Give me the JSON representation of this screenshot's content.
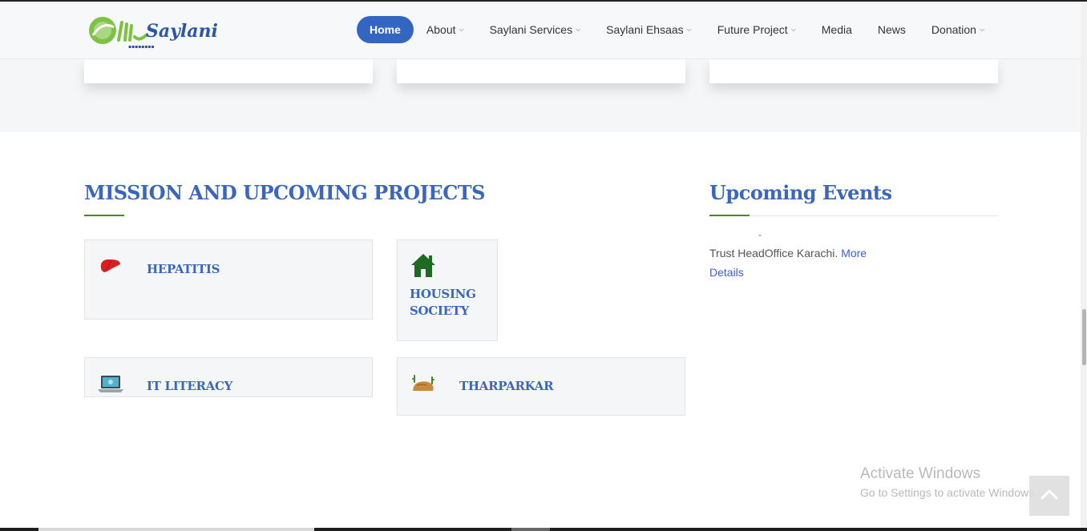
{
  "header": {
    "logo_text": "Saylani",
    "nav": [
      {
        "label": "Home",
        "active": true,
        "dropdown": false
      },
      {
        "label": "About",
        "active": false,
        "dropdown": true
      },
      {
        "label": "Saylani Services",
        "active": false,
        "dropdown": true
      },
      {
        "label": "Saylani Ehsaas",
        "active": false,
        "dropdown": true
      },
      {
        "label": "Future Project",
        "active": false,
        "dropdown": true
      },
      {
        "label": "Media",
        "active": false,
        "dropdown": false
      },
      {
        "label": "News",
        "active": false,
        "dropdown": false
      },
      {
        "label": "Donation",
        "active": false,
        "dropdown": true
      }
    ]
  },
  "mission": {
    "title": "MISSION AND UPCOMING PROJECTS",
    "projects": [
      {
        "label": "HEPATITIS",
        "icon": "liver-icon"
      },
      {
        "label": "HOUSING SOCIETY",
        "icon": "house-icon"
      },
      {
        "label": "IT LITERACY",
        "icon": "laptop-icon"
      },
      {
        "label": "THARPARKAR",
        "icon": "desert-rock-icon"
      }
    ]
  },
  "events": {
    "title": "Upcoming Events",
    "dash": "-",
    "text": "Trust HeadOffice Karachi.",
    "more_link": "More Details"
  },
  "watermark": {
    "line1": "Activate Windows",
    "line2": "Go to Settings to activate Windows."
  },
  "colors": {
    "brand_blue": "#3366c3",
    "heading_blue": "#3a67bd",
    "accent_green": "#4b8a1e",
    "link_blue": "#3b5ed8"
  }
}
